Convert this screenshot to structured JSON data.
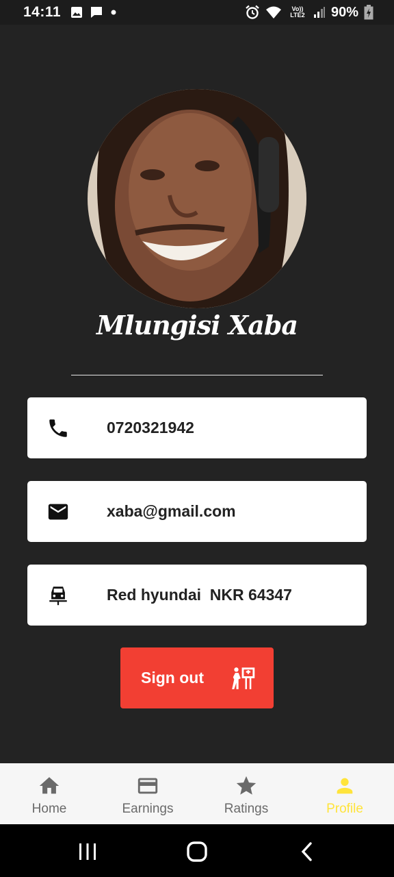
{
  "status_bar": {
    "time": "14:11",
    "network": "Vo)) LTE2",
    "battery": "90%"
  },
  "profile": {
    "name": "Mlungisi Xaba",
    "phone": "0720321942",
    "email": "xaba@gmail.com",
    "vehicle": "Red hyundai  NKR 64347"
  },
  "actions": {
    "sign_out_label": "Sign out"
  },
  "bottom_nav": {
    "items": [
      {
        "label": "Home",
        "icon": "home-icon"
      },
      {
        "label": "Earnings",
        "icon": "card-icon"
      },
      {
        "label": "Ratings",
        "icon": "star-icon"
      },
      {
        "label": "Profile",
        "icon": "person-icon"
      }
    ],
    "active_index": 3
  },
  "colors": {
    "background": "#232323",
    "accent_red": "#f23f33",
    "active_nav": "#ffe43b",
    "inactive_nav": "#6a6a6a"
  }
}
